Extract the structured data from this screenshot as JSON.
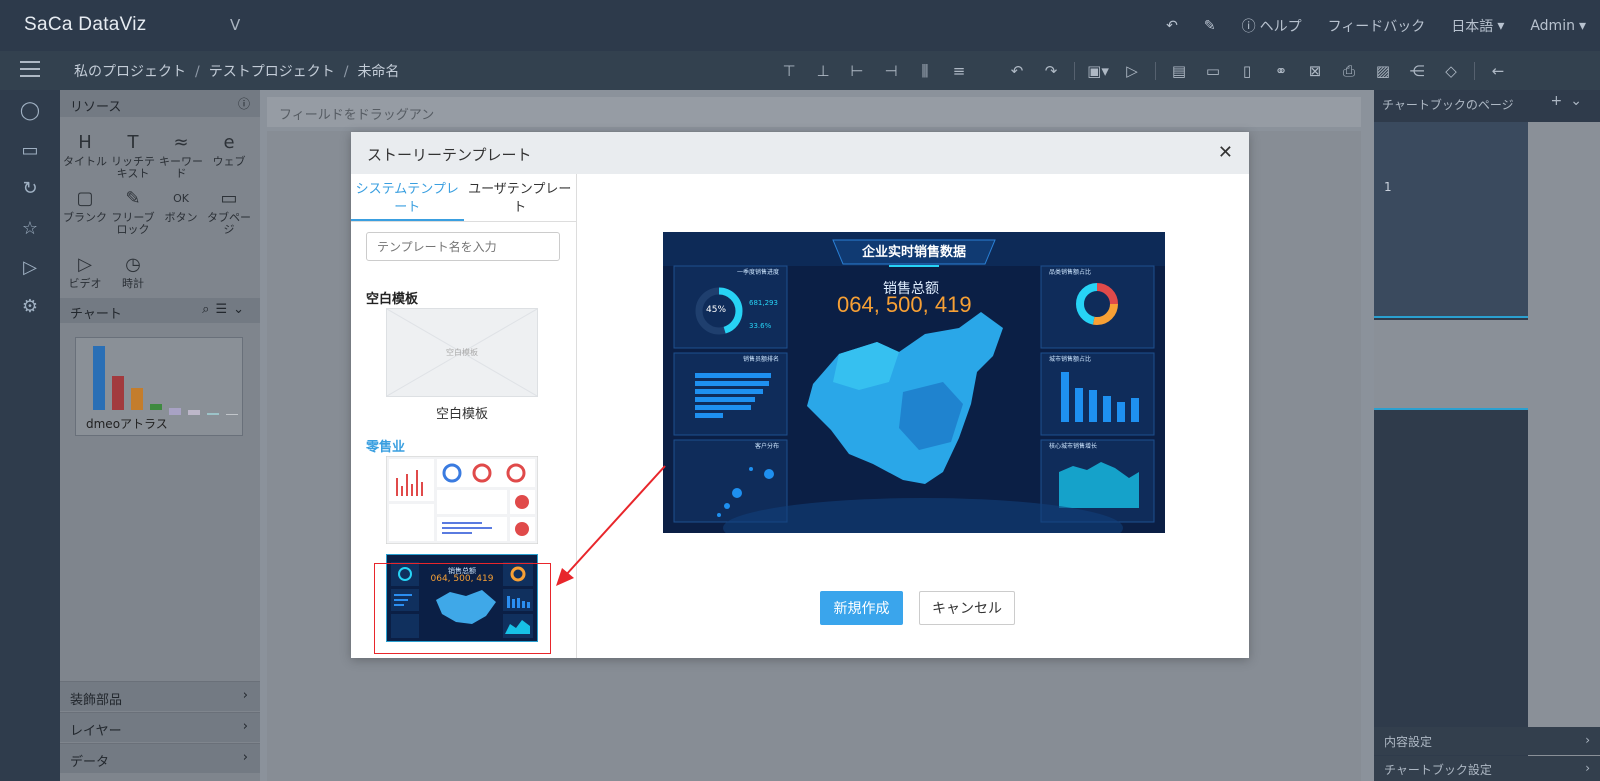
{
  "app": {
    "logo": "SaCa DataViz",
    "version_mark": "V"
  },
  "topbar": {
    "help": "ヘルプ",
    "feedback": "フィードバック",
    "language": "日本語",
    "user": "Admin"
  },
  "breadcrumb": [
    "私のプロジェクト",
    "テストプロジェクト",
    "未命名"
  ],
  "resource_panel": {
    "title": "リソース",
    "items": [
      "タイトル",
      "リッチテキスト",
      "キーワード",
      "ウェブ",
      "ブランク",
      "フリーブロック",
      "ボタン",
      "タブページ",
      "ビデオ",
      "時計"
    ],
    "glyphs": [
      "H",
      "T",
      "≈",
      "e",
      "▢",
      "✎",
      "OK",
      "▭",
      "▷",
      "◷"
    ]
  },
  "chart_panel": {
    "title": "チャート",
    "thumbnail_label": "dmeoアトラス"
  },
  "bottom_sections": [
    "装飾部品",
    "レイヤー",
    "データ"
  ],
  "canvas": {
    "field_placeholder": "フィールドをドラッグアン"
  },
  "right_panel": {
    "title": "チャートブックのページ",
    "page_number": "1",
    "content_settings": "内容設定",
    "book_settings": "チャートブック設定"
  },
  "dialog": {
    "title": "ストーリーテンプレート",
    "tabs": [
      "システムテンプレート",
      "ユーザテンプレート"
    ],
    "search_placeholder": "テンプレート名を入力",
    "group_blank": "空白模板",
    "blank_thumb_text": "空白模板",
    "blank_caption": "空白模板",
    "group_retail": "零售业",
    "create_button": "新規作成",
    "cancel_button": "キャンセル"
  },
  "preview": {
    "title": "企业实时销售数据",
    "total_label": "销售总额",
    "total_value": "064, 500, 419",
    "panel_titles": [
      "一季度销售进度",
      "销售员额排名",
      "客户分布",
      "品类销售额占比",
      "城市销售额占比",
      "核心城市销售增长"
    ],
    "progress": "45%",
    "mini_values": [
      "681,293",
      "33.6%"
    ]
  },
  "colors": {
    "accent": "#3aa5ec",
    "topbar": "#2d3a4b",
    "highlight": "#e8262b",
    "preview_bg": "#0b1f45",
    "orange": "#f7a035"
  }
}
